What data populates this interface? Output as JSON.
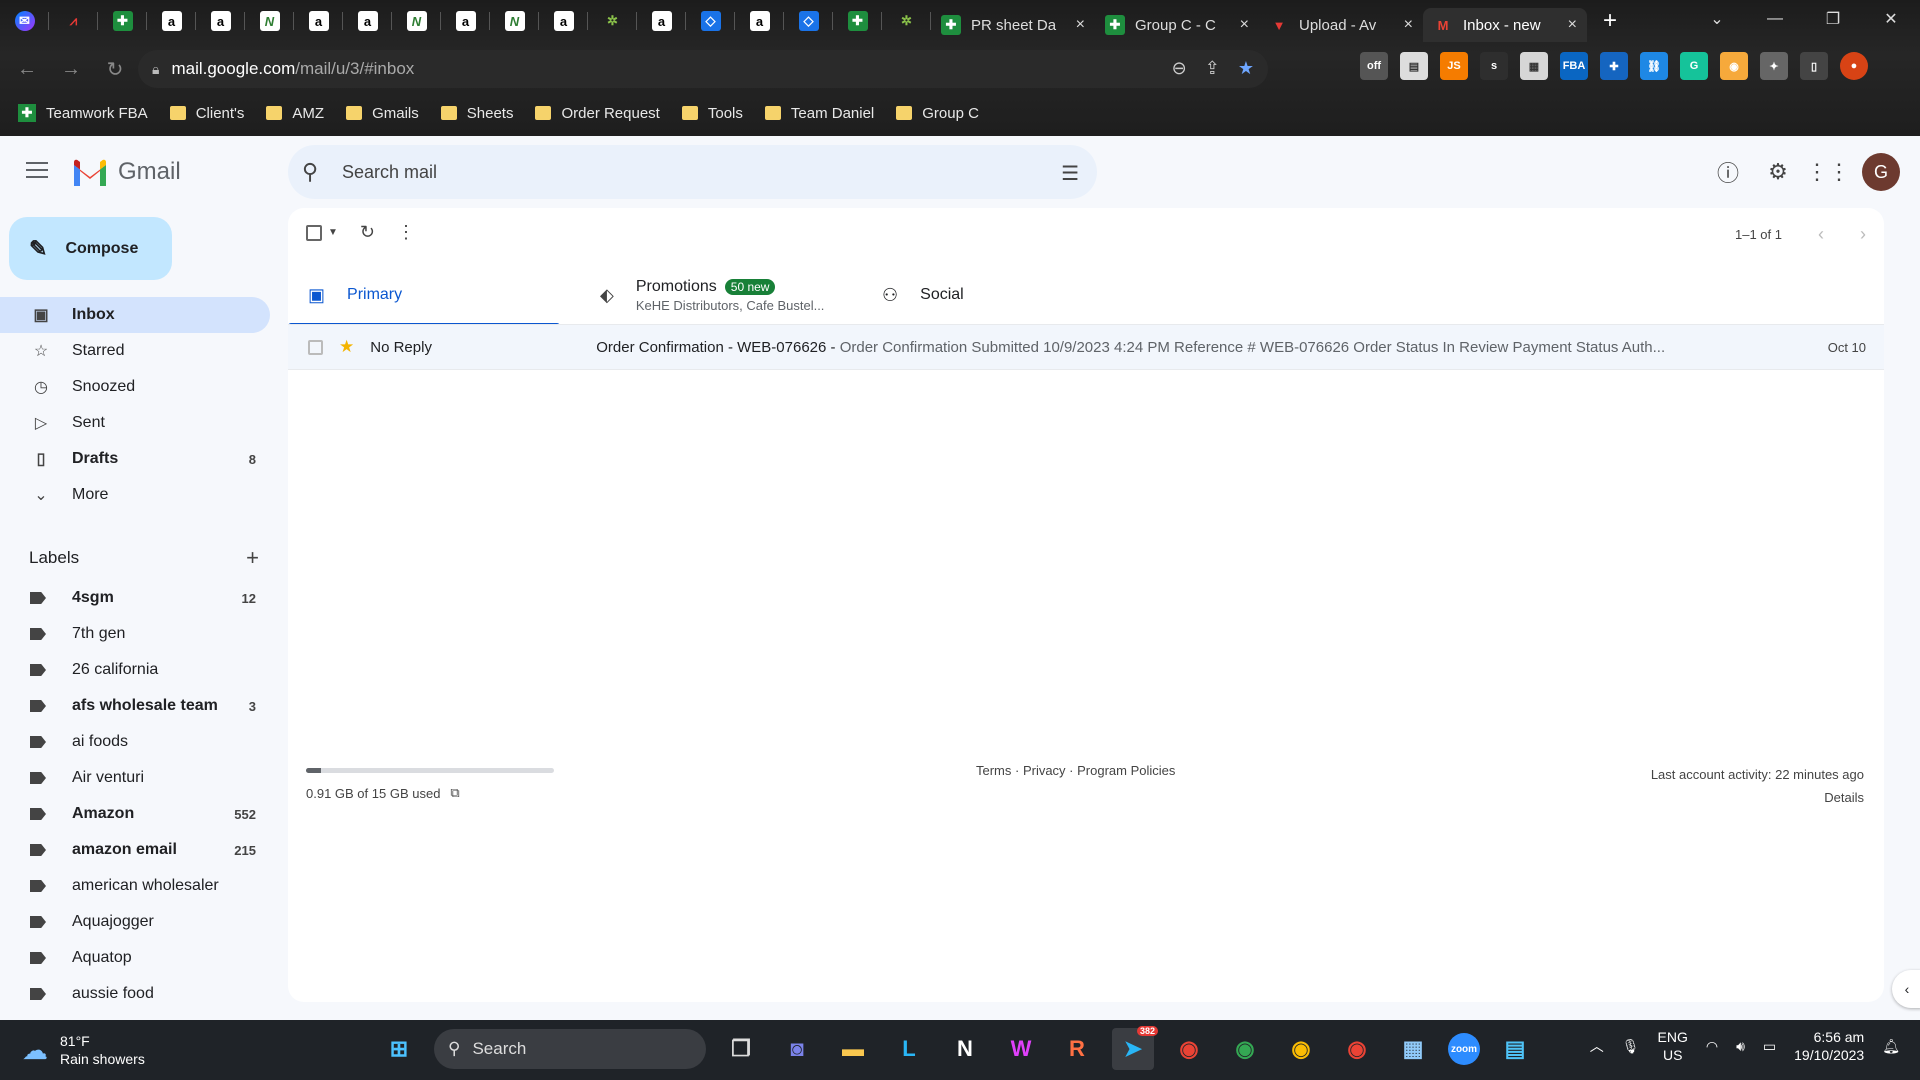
{
  "browser": {
    "pinned_tabs": [
      "messenger",
      "chart",
      "sheet",
      "amazon",
      "amazon",
      "n-app",
      "amazon",
      "amazon",
      "n-app",
      "amazon",
      "n-app",
      "amazon",
      "leaf",
      "amazon",
      "blue-diamond",
      "amazon",
      "blue-diamond",
      "sheet",
      "leaf"
    ],
    "tabs": [
      {
        "title": "PR sheet Da",
        "icon": "sheets-icon",
        "close": "×"
      },
      {
        "title": "Group C - C",
        "icon": "sheets-icon",
        "close": "×"
      },
      {
        "title": "Upload - Av",
        "icon": "upload-icon",
        "close": "×"
      },
      {
        "title": "Inbox - new",
        "icon": "gmail-icon",
        "close": "×",
        "active": true
      }
    ],
    "new_tab": "+",
    "window_controls": [
      "⌄",
      "—",
      "❐",
      "✕"
    ],
    "url_host": "mail.google.com",
    "url_path": "/mail/u/3/#inbox",
    "extensions": [
      {
        "label": "off",
        "color": "#555555"
      },
      {
        "label": "▤",
        "color": "#dddddd"
      },
      {
        "label": "JS",
        "color": "#f57c00"
      },
      {
        "label": "s",
        "color": "#2e2e2e"
      },
      {
        "label": "▦",
        "color": "#d6d6d6"
      },
      {
        "label": "FBA",
        "color": "#0a66c2"
      },
      {
        "label": "✚",
        "color": "#1565c0"
      },
      {
        "label": "⛓",
        "color": "#1e88e5"
      },
      {
        "label": "G",
        "color": "#15c39a"
      },
      {
        "label": "◉",
        "color": "#f6a93b"
      },
      {
        "label": "✦",
        "color": "#666666"
      },
      {
        "label": "▯",
        "color": "#444444"
      }
    ],
    "bookmarks": [
      {
        "label": "Teamwork FBA",
        "type": "sheet"
      },
      {
        "label": "Client's",
        "type": "folder"
      },
      {
        "label": "AMZ",
        "type": "folder"
      },
      {
        "label": "Gmails",
        "type": "folder"
      },
      {
        "label": "Sheets",
        "type": "folder"
      },
      {
        "label": "Order Request",
        "type": "folder"
      },
      {
        "label": "Tools",
        "type": "folder"
      },
      {
        "label": "Team Daniel",
        "type": "folder"
      },
      {
        "label": "Group C",
        "type": "folder"
      }
    ]
  },
  "gmail": {
    "brand": "Gmail",
    "search_placeholder": "Search mail",
    "avatar_initial": "G",
    "compose_label": "Compose",
    "nav": [
      {
        "label": "Inbox",
        "icon": "inbox-icon",
        "glyph": "▣",
        "count": "",
        "active": true
      },
      {
        "label": "Starred",
        "icon": "star-icon",
        "glyph": "☆",
        "count": ""
      },
      {
        "label": "Snoozed",
        "icon": "clock-icon",
        "glyph": "◷",
        "count": ""
      },
      {
        "label": "Sent",
        "icon": "send-icon",
        "glyph": "▷",
        "count": ""
      },
      {
        "label": "Drafts",
        "icon": "draft-icon",
        "glyph": "▯",
        "count": "8",
        "bold": true
      },
      {
        "label": "More",
        "icon": "chevron-down-icon",
        "glyph": "⌄",
        "count": ""
      }
    ],
    "labels_title": "Labels",
    "labels": [
      {
        "label": "4sgm",
        "count": "12",
        "bold": true
      },
      {
        "label": "7th gen",
        "count": ""
      },
      {
        "label": "26 california",
        "count": ""
      },
      {
        "label": "afs wholesale team",
        "count": "3",
        "bold": true
      },
      {
        "label": "ai foods",
        "count": ""
      },
      {
        "label": "Air venturi",
        "count": ""
      },
      {
        "label": "Amazon",
        "count": "552",
        "bold": true
      },
      {
        "label": "amazon email",
        "count": "215",
        "bold": true
      },
      {
        "label": "american wholesaler",
        "count": ""
      },
      {
        "label": "Aquajogger",
        "count": ""
      },
      {
        "label": "Aquatop",
        "count": ""
      },
      {
        "label": "aussie food",
        "count": ""
      }
    ],
    "pager": "1–1 of 1",
    "tabs": {
      "primary": "Primary",
      "promotions": "Promotions",
      "promotions_badge": "50 new",
      "promotions_sub": "KeHE Distributors, Cafe Bustel...",
      "social": "Social"
    },
    "email": {
      "sender": "No Reply",
      "subject": "Order Confirmation - WEB-076626",
      "separator": " - ",
      "snippet": "Order Confirmation Submitted 10/9/2023 4:24 PM Reference # WEB-076626 Order Status In Review Payment Status Auth...",
      "date": "Oct 10",
      "starred": true
    },
    "storage_text": "0.91 GB of 15 GB used",
    "storage_fraction": 0.061,
    "footer_links": "Terms · Privacy · Program Policies",
    "last_activity": "Last account activity: 22 minutes ago",
    "details": "Details"
  },
  "taskbar": {
    "temp": "81°F",
    "weather": "Rain showers",
    "search": "Search",
    "apps": [
      {
        "name": "windows-start-icon",
        "glyph": "⊞",
        "color": "#4cc2ff"
      },
      {
        "name": "search-box",
        "glyph": "",
        "color": ""
      },
      {
        "name": "task-view-icon",
        "glyph": "❐",
        "color": "#dddddd"
      },
      {
        "name": "teams-chat-icon",
        "glyph": "◙",
        "color": "#7b83eb"
      },
      {
        "name": "file-explorer-icon",
        "glyph": "▬",
        "color": "#f9c74f"
      },
      {
        "name": "app-l-icon",
        "glyph": "L",
        "color": "#29b6f6"
      },
      {
        "name": "notion-icon",
        "glyph": "N",
        "color": "#ffffff"
      },
      {
        "name": "wps-icon",
        "glyph": "W",
        "color": "#e040fb"
      },
      {
        "name": "app-r-icon",
        "glyph": "R",
        "color": "#ff7043"
      },
      {
        "name": "telegram-icon",
        "glyph": "➤",
        "color": "#29b6f6"
      },
      {
        "name": "chrome-icon",
        "glyph": "◉",
        "color": "#ea4335"
      },
      {
        "name": "chrome-icon",
        "glyph": "◉",
        "color": "#34a853"
      },
      {
        "name": "chrome-icon",
        "glyph": "◉",
        "color": "#fbbc04"
      },
      {
        "name": "chrome-icon",
        "glyph": "◉",
        "color": "#ea4335"
      },
      {
        "name": "calculator-icon",
        "glyph": "▦",
        "color": "#90caf9"
      },
      {
        "name": "zoom-icon",
        "glyph": "zoom",
        "color": "#2d8cff"
      },
      {
        "name": "notepad-icon",
        "glyph": "▤",
        "color": "#4fc3f7"
      }
    ],
    "telegram_badge": "382",
    "lang_top": "ENG",
    "lang_bottom": "US",
    "time": "6:56 am",
    "date": "19/10/2023"
  }
}
